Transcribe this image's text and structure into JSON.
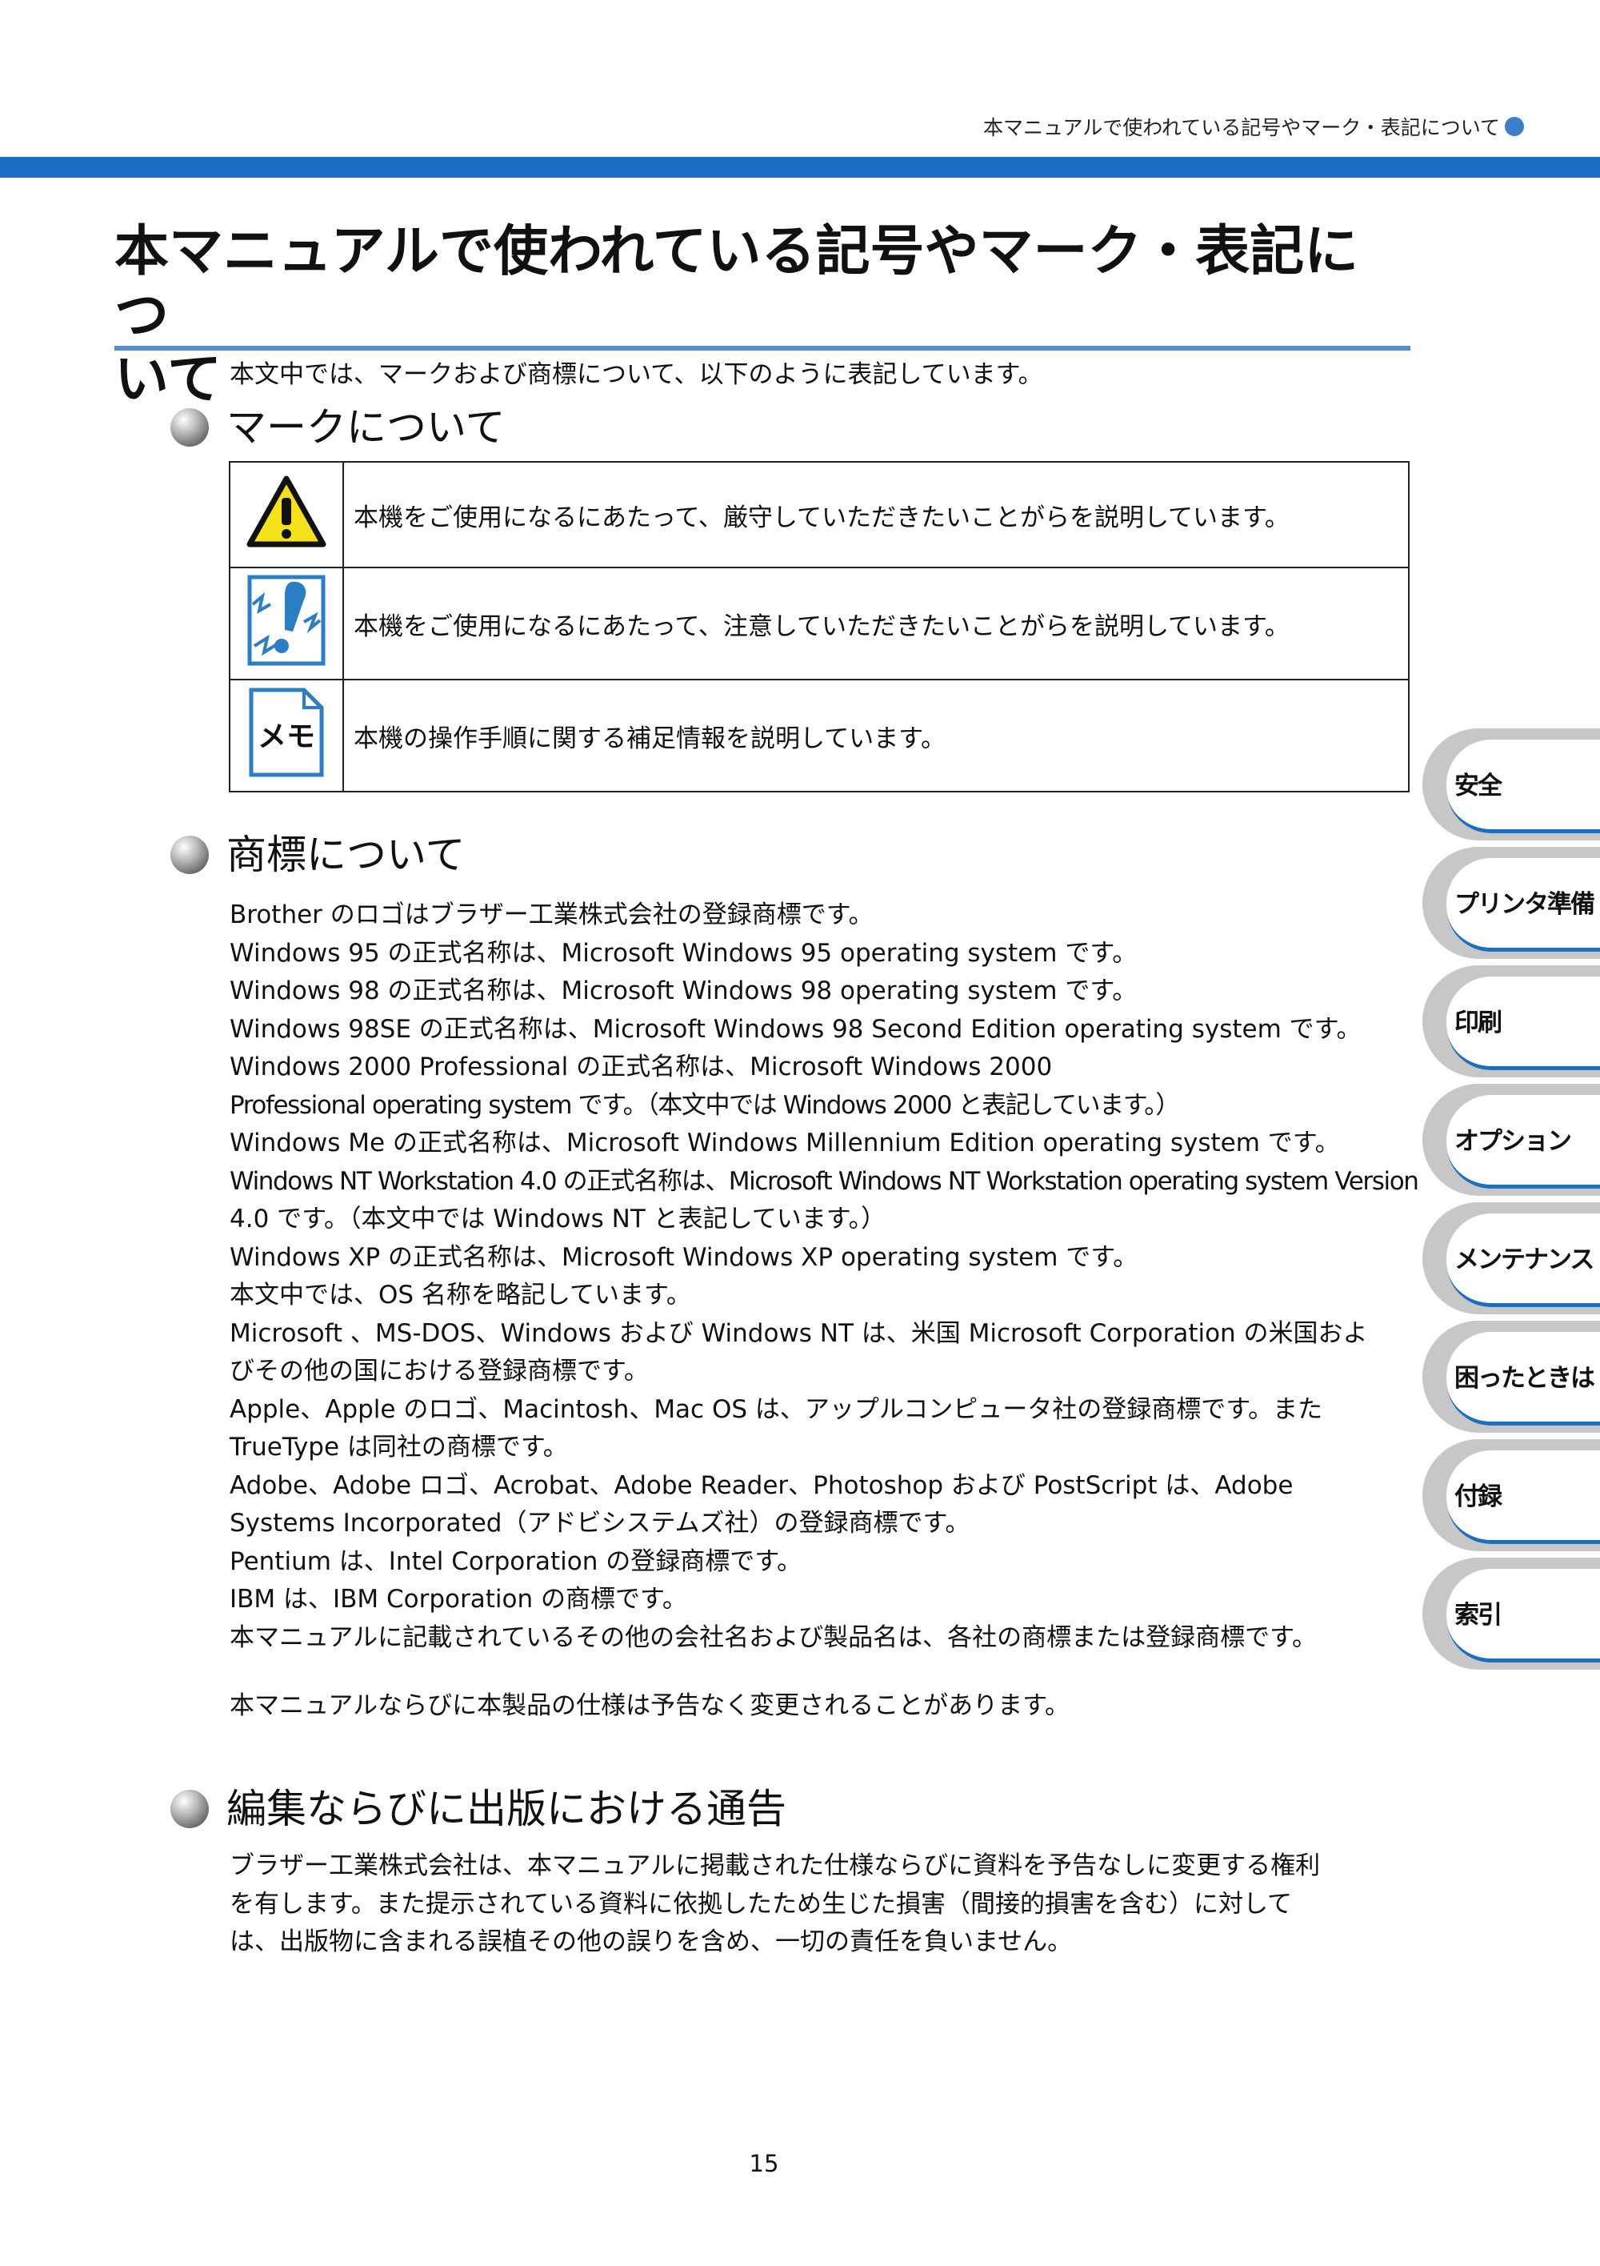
{
  "running_header": "本マニュアルで使われている記号やマーク・表記について",
  "title_lines": [
    "本マニュアルで使われている記号やマーク・表記につ",
    "いて"
  ],
  "intro": "本文中では、マークおよび商標について、以下のように表記しています。",
  "sections": {
    "marks": {
      "heading": "マークについて",
      "rows": [
        {
          "icon": "warning-icon",
          "text": "本機をご使用になるにあたって、厳守していただきたいことがらを説明しています。"
        },
        {
          "icon": "caution-icon",
          "text": "本機をご使用になるにあたって、注意していただきたいことがらを説明しています。"
        },
        {
          "icon": "memo-icon",
          "icon_text": "メモ",
          "text": "本機の操作手順に関する補足情報を説明しています。"
        }
      ]
    },
    "trademarks": {
      "heading": "商標について",
      "lines": [
        "Brother のロゴはブラザー工業株式会社の登録商標です。",
        "Windows 95 の正式名称は、Microsoft Windows 95 operating system です。",
        "Windows 98 の正式名称は、Microsoft Windows 98 operating system です。",
        "Windows 98SE の正式名称は、Microsoft Windows 98 Second Edition operating system です。",
        "Windows 2000 Professional の正式名称は、Microsoft Windows 2000",
        "Professional operating system です。（本文中では Windows 2000 と表記しています。）",
        "Windows Me の正式名称は、Microsoft Windows Millennium Edition operating system です。",
        "Windows NT Workstation 4.0 の正式名称は、Microsoft Windows NT Workstation operating system Version",
        "4.0 です。（本文中では Windows NT と表記しています。）",
        "Windows XP の正式名称は、Microsoft Windows XP operating system です。",
        "本文中では、OS 名称を略記しています。",
        "Microsoft 、MS-DOS、Windows および Windows NT は、米国 Microsoft Corporation の米国およ",
        "びその他の国における登録商標です。",
        "Apple、Apple のロゴ、Macintosh、Mac OS は、アップルコンピュータ社の登録商標です。また",
        "TrueType は同社の商標です。",
        "Adobe、Adobe ロゴ、Acrobat、Adobe Reader、Photoshop および PostScript は、Adobe",
        "Systems Incorporated（アドビシステムズ社）の登録商標です。",
        "Pentium は、Intel Corporation の登録商標です。",
        "IBM は、IBM Corporation の商標です。",
        "本マニュアルに記載されているその他の会社名および製品名は、各社の商標または登録商標です。"
      ],
      "note": "本マニュアルならびに本製品の仕様は予告なく変更されることがあります。"
    },
    "publishing": {
      "heading": "編集ならびに出版における通告",
      "lines": [
        "ブラザー工業株式会社は、本マニュアルに掲載された仕様ならびに資料を予告なしに変更する権利",
        "を有します。また提示されている資料に依拠したため生じた損害（間接的損害を含む）に対して",
        "は、出版物に含まれる誤植その他の誤りを含め、一切の責任を負いません。"
      ]
    }
  },
  "side_tabs": [
    "安全",
    "プリンタ準備",
    "印刷",
    "オプション",
    "メンテナンス",
    "困ったときは",
    "付録",
    "索引"
  ],
  "page_number": "15",
  "colors": {
    "accent_blue": "#1b6fc0",
    "rule_blue": "#5b8ccb",
    "tab_gray": "#c7c7c7"
  }
}
